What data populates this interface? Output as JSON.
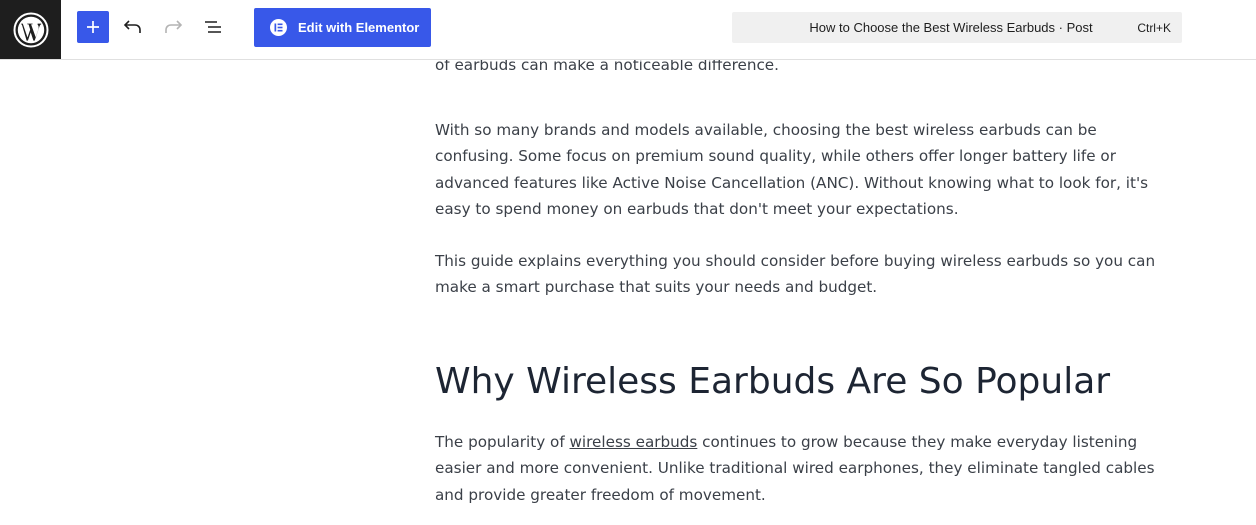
{
  "toolbar": {
    "logo_icon": "wordpress-logo-icon",
    "add_icon": "plus-icon",
    "undo_icon": "undo-icon",
    "redo_icon": "redo-icon",
    "list_view_icon": "list-view-icon",
    "elementor_label": "Edit with Elementor",
    "accent_color": "#3858e9"
  },
  "command_bar": {
    "title": "How to Choose the Best Wireless Earbuds · Post",
    "shortcut": "Ctrl+K"
  },
  "content": {
    "p0_partial": "of earbuds can make a noticeable difference.",
    "p1": "With so many brands and models available, choosing the best wireless earbuds can be confusing. Some focus on premium sound quality, while others offer longer battery life or advanced features like Active Noise Cancellation (ANC). Without knowing what to look for, it's easy to spend money on earbuds that don't meet your expectations.",
    "p2": "This guide explains everything you should consider before buying wireless earbuds so you can make a smart purchase that suits your needs and budget.",
    "heading": "Why Wireless Earbuds Are So Popular",
    "p4_before": "The popularity of ",
    "p4_link": "wireless earbuds",
    "p4_after": " continues to grow because they make everyday listening easier and more convenient. Unlike traditional wired earphones, they eliminate tangled cables and provide greater freedom of movement."
  }
}
